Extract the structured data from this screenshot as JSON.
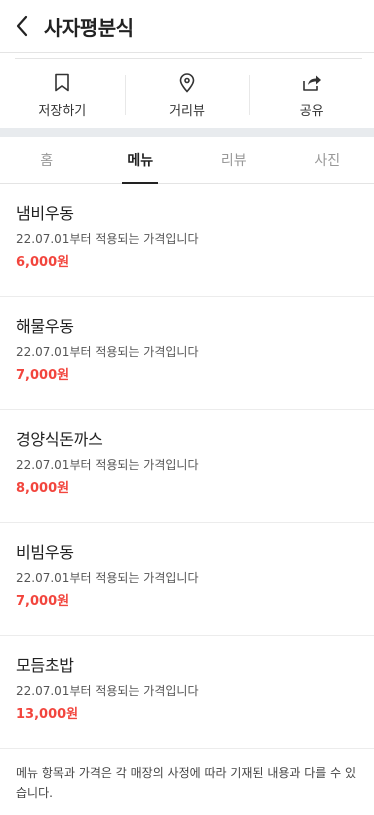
{
  "header": {
    "title": "사자평분식",
    "back_icon": "chevron-left-icon"
  },
  "actions": [
    {
      "label": "저장하기",
      "icon": "bookmark-icon"
    },
    {
      "label": "거리뷰",
      "icon": "map-pin-icon"
    },
    {
      "label": "공유",
      "icon": "share-icon"
    }
  ],
  "tabs": [
    {
      "label": "홈",
      "active": false
    },
    {
      "label": "메뉴",
      "active": true
    },
    {
      "label": "리뷰",
      "active": false
    },
    {
      "label": "사진",
      "active": false
    }
  ],
  "menu": [
    {
      "name": "냄비우동",
      "desc": "22.07.01부터 적용되는 가격입니다",
      "price": "6,000원"
    },
    {
      "name": "해물우동",
      "desc": "22.07.01부터 적용되는 가격입니다",
      "price": "7,000원"
    },
    {
      "name": "경양식돈까스",
      "desc": "22.07.01부터 적용되는 가격입니다",
      "price": "8,000원"
    },
    {
      "name": "비빔우동",
      "desc": "22.07.01부터 적용되는 가격입니다",
      "price": "7,000원"
    },
    {
      "name": "모듬초밥",
      "desc": "22.07.01부터 적용되는 가격입니다",
      "price": "13,000원"
    }
  ],
  "notice": "메뉴 항목과 가격은 각 매장의 사정에 따라 기재된 내용과 다를 수 있습니다.",
  "colors": {
    "price": "#f2453d",
    "divider": "#e8ebee"
  }
}
